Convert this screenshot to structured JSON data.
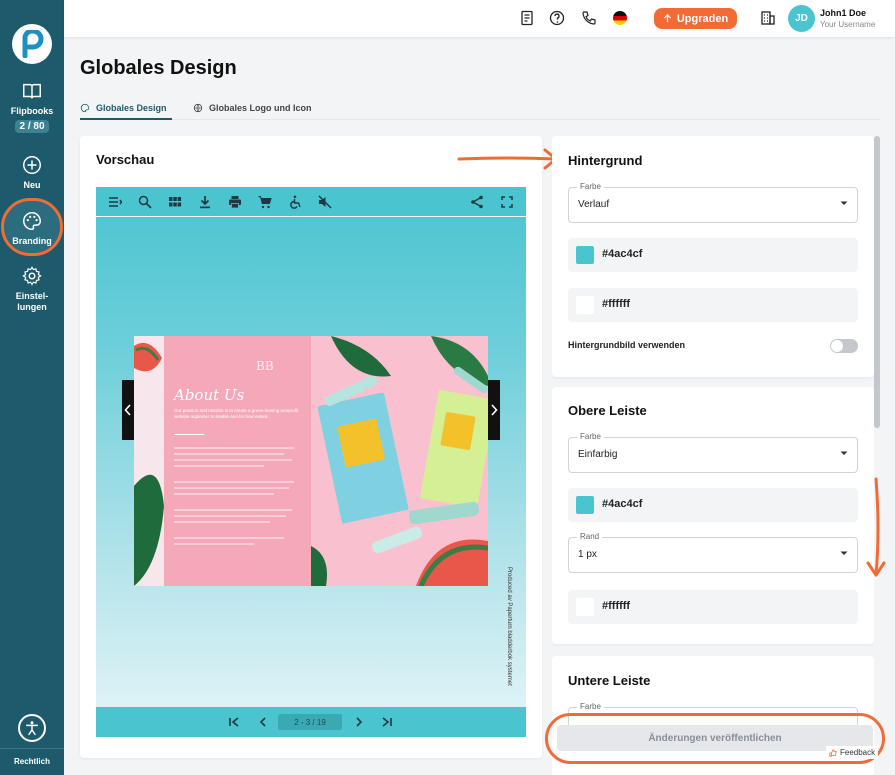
{
  "sidebar": {
    "items": [
      {
        "label": "Flipbooks",
        "badge": "2 / 80",
        "icon": "book-icon"
      },
      {
        "label": "Neu",
        "icon": "plus-circle-icon"
      },
      {
        "label": "Branding",
        "icon": "palette-icon"
      },
      {
        "label": "Einstel-\nlungen",
        "icon": "gear-icon"
      }
    ],
    "footer": "Rechtlich"
  },
  "topbar": {
    "upgrade_label": "Upgraden",
    "user": {
      "initials": "JD",
      "name": "John1 Doe",
      "username": "Your Username"
    }
  },
  "page": {
    "title": "Globales Design",
    "tabs": [
      {
        "label": "Globales Design",
        "active": true
      },
      {
        "label": "Globales Logo und Icon",
        "active": false
      }
    ]
  },
  "preview": {
    "title": "Vorschau",
    "page_indicator": "2 - 3 / 19",
    "book_heading": "About Us",
    "book_intro": "Our passion and mission is to create a green-leaning nonprofit website organizer to enable and for how extent.",
    "produced_by": "Produced av Paperturn bladderbok systemet"
  },
  "settings": {
    "background": {
      "title": "Hintergrund",
      "farbe_label": "Farbe",
      "farbe_value": "Verlauf",
      "color1": "#4ac4cf",
      "color2": "#ffffff",
      "bg_image_label": "Hintergrundbild verwenden",
      "bg_image_enabled": false
    },
    "top_bar": {
      "title": "Obere Leiste",
      "farbe_label": "Farbe",
      "farbe_value": "Einfarbig",
      "color1": "#4ac4cf",
      "rand_label": "Rand",
      "rand_value": "1 px",
      "color2": "#ffffff"
    },
    "bottom_bar": {
      "title": "Untere Leiste",
      "farbe_label": "Farbe"
    }
  },
  "publish_label": "Änderungen veröffentlichen",
  "feedback_label": "Feedback",
  "colors": {
    "sidebar": "#1d5a6b",
    "accent": "#f26b35",
    "viewer": "#4ac4cf"
  }
}
